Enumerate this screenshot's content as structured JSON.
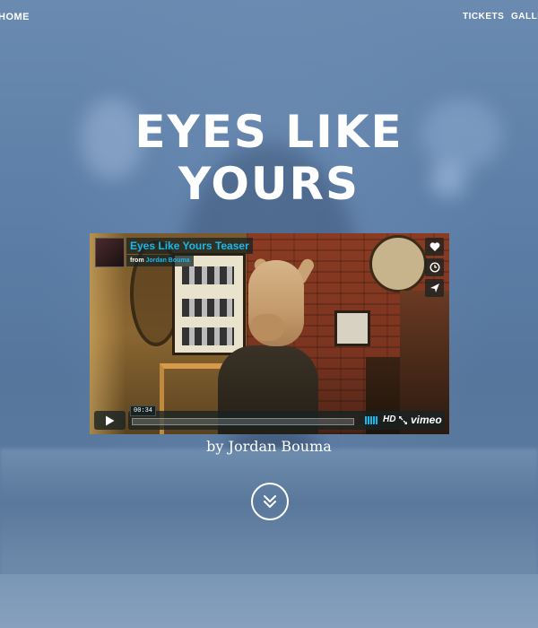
{
  "nav": {
    "home": "HOME",
    "tickets": "TICKETS",
    "gallery": "GALLERY"
  },
  "hero": {
    "title_line1": "EYES LIKE",
    "title_line2": "YOURS",
    "credit": "by Jordan Bouma"
  },
  "video": {
    "title": "Eyes Like Yours Teaser",
    "from_prefix": "from",
    "author": "Jordan Bouma",
    "time": "00:34",
    "progress_fraction": 0.0,
    "hd_label": "HD",
    "brand": "vimeo",
    "side_buttons": [
      "heart-icon",
      "clock-icon",
      "send-icon"
    ],
    "accent_color": "#1ab7ea"
  },
  "colors": {
    "overlay": "#5d7ea3",
    "text": "#ffffff"
  }
}
